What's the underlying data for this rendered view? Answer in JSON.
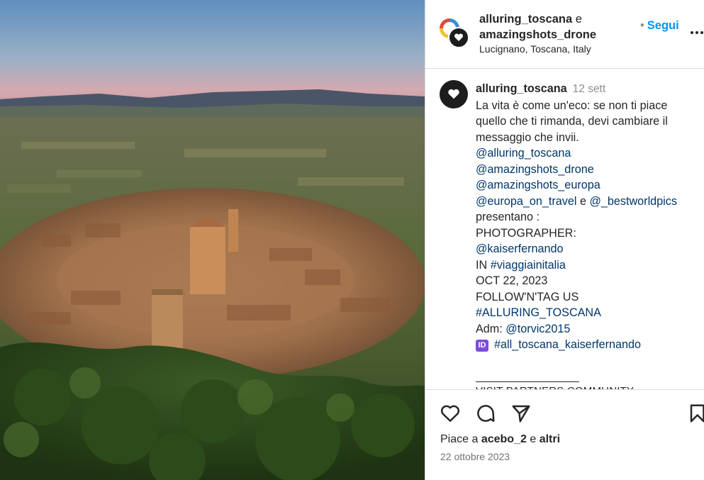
{
  "header": {
    "user1": "alluring_toscana",
    "conjunction": "e",
    "user2": "amazingshots_drone",
    "location": "Lucignano, Toscana, Italy",
    "follow_label": "Segui"
  },
  "caption": {
    "username": "alluring_toscana",
    "time": "12 sett",
    "lines": [
      "La vita è come un'eco: se non ti piace quello che ti rimanda, devi cambiare il messaggio che invii."
    ],
    "mentions": [
      "@alluring_toscana",
      "@amazingshots_drone",
      "@amazingshots_europa",
      "@europa_on_travel",
      "@_bestworldpics"
    ],
    "and_word": "e",
    "presentano": "presentano :",
    "photographer_label": "PHOTOGRAPHER:",
    "photographer": "@kaiserfernando",
    "in_prefix": "IN",
    "in_tag": "#viaggiainitalia",
    "date_line": "OCT 22, 2023",
    "follow_tag": "FOLLOW'N'TAG US",
    "main_tag": "#ALLURING_TOSCANA",
    "adm_prefix": "Adm:",
    "adm_user": "@torvic2015",
    "id_badge": "ID",
    "kaiser_tag": "#all_toscana_kaiserfernando",
    "partners_cut": "VISIT PARTNERS COMMUNITY"
  },
  "footer": {
    "likes_prefix": "Piace a",
    "likes_user": "acebo_2",
    "likes_mid": "e",
    "likes_others": "altri",
    "date": "22 ottobre 2023"
  },
  "icons": {
    "like": "heart-icon",
    "comment": "comment-icon",
    "share": "share-icon",
    "save": "bookmark-icon",
    "more": "more-icon"
  },
  "colors": {
    "link_blue": "#0095f6",
    "mention": "#00376b",
    "muted": "#8e8e8e"
  }
}
